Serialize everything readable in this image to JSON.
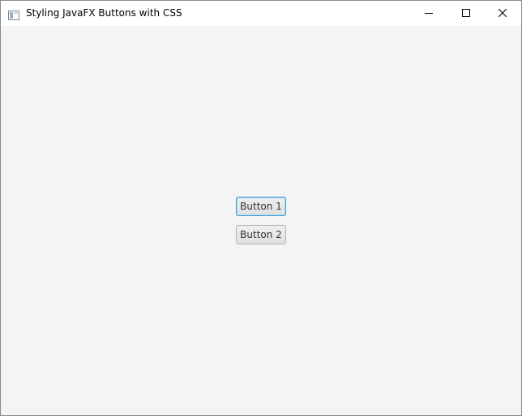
{
  "window": {
    "title": "Styling JavaFX Buttons with CSS",
    "app_icon": "javafx-window-icon",
    "controls": {
      "minimize_icon": "minimize-icon",
      "maximize_icon": "maximize-icon",
      "close_icon": "close-icon"
    }
  },
  "content": {
    "buttons": [
      {
        "label": "Button 1",
        "focused": true
      },
      {
        "label": "Button 2",
        "focused": false
      }
    ]
  },
  "colors": {
    "background": "#f4f4f4",
    "titlebar": "#ffffff",
    "focus_ring": "#3e9ed6",
    "button_border": "#b5b5b5"
  }
}
